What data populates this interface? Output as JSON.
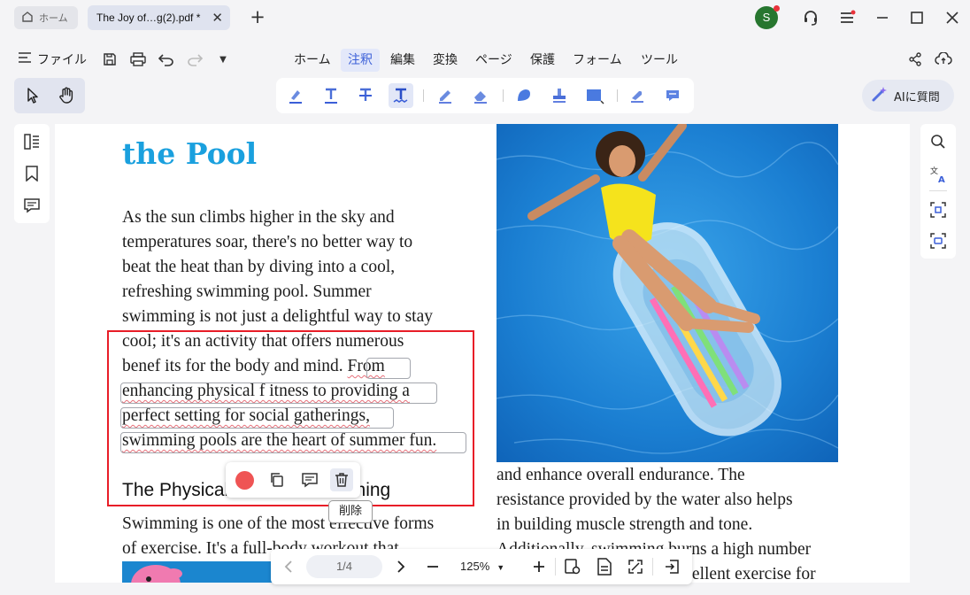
{
  "titlebar": {
    "home_tab": "ホーム",
    "doc_tab": "The Joy of…g(2).pdf *",
    "avatar_letter": "S"
  },
  "menu": {
    "file_label": "ファイル",
    "items": [
      "ホーム",
      "注釈",
      "編集",
      "変換",
      "ページ",
      "保護",
      "フォーム",
      "ツール"
    ],
    "active": "注釈"
  },
  "ai_button": "AIに質問",
  "document": {
    "heading": "the Pool",
    "para1": [
      "As the sun climbs higher in the sky and",
      "temperatures soar, there's no better way to",
      "beat the heat than by diving into a cool,",
      "refreshing swimming pool. Summer",
      "swimming is not just a delightful way to stay",
      "cool; it's an activity that offers numerous"
    ],
    "para1_line7_start": "benef  its for the body and mind. ",
    "para1_line7_hl": "From",
    "para1_hl_lines": [
      "enhancing physical f  itness to providing a",
      "perfect setting for social gatherings,",
      "swimming pools are the heart of summer fun."
    ],
    "heading2_start": "The Physical",
    "heading2_end": "mming",
    "para3": [
      "Swimming is one of the most effective forms",
      "of exercise. It's a full-body workout that"
    ],
    "para2": [
      "and enhance overall endurance. The",
      "resistance provided by the water also helps",
      "in building muscle strength and tone.",
      "Additionally, swimming burns a high number",
      "of calories, making it an excellent exercise for"
    ]
  },
  "popup": {
    "tooltip": "削除",
    "color": "#ef5454"
  },
  "bottombar": {
    "page": "1/4",
    "zoom": "125%"
  },
  "colors": {
    "accent": "#3b5fd8",
    "heading": "#1aa0de",
    "selection": "#e81d27"
  }
}
